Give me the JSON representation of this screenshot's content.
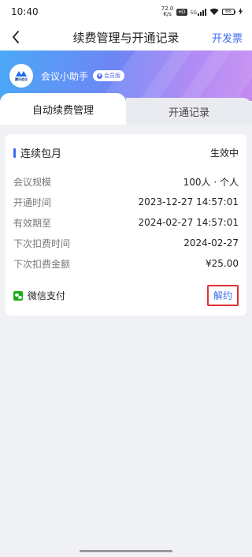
{
  "status_bar": {
    "time": "10:40",
    "speed_top": "72.0",
    "speed_unit": "K/s",
    "hd_label": "HD",
    "net_label": "5G",
    "battery": "66"
  },
  "nav": {
    "title": "续费管理与开通记录",
    "invoice_label": "开发票"
  },
  "banner": {
    "logo_text": "腾讯会议",
    "name": "会议小助手",
    "badge": "会员版"
  },
  "tabs": [
    {
      "label": "自动续费管理",
      "active": true
    },
    {
      "label": "开通记录",
      "active": false
    }
  ],
  "subscription": {
    "title": "连续包月",
    "status": "生效中",
    "rows": [
      {
        "label": "会议规模",
        "value": "100人 · 个人"
      },
      {
        "label": "开通时间",
        "value": "2023-12-27 14:57:01"
      },
      {
        "label": "有效期至",
        "value": "2024-02-27 14:57:01"
      },
      {
        "label": "下次扣费时间",
        "value": "2024-02-27"
      },
      {
        "label": "下次扣费金额",
        "value": "¥25.00"
      }
    ],
    "payment_method": "微信支付",
    "cancel_label": "解约"
  },
  "colors": {
    "accent": "#3a6cf0",
    "highlight_border": "#e03131",
    "wechat_green": "#1aad19"
  }
}
